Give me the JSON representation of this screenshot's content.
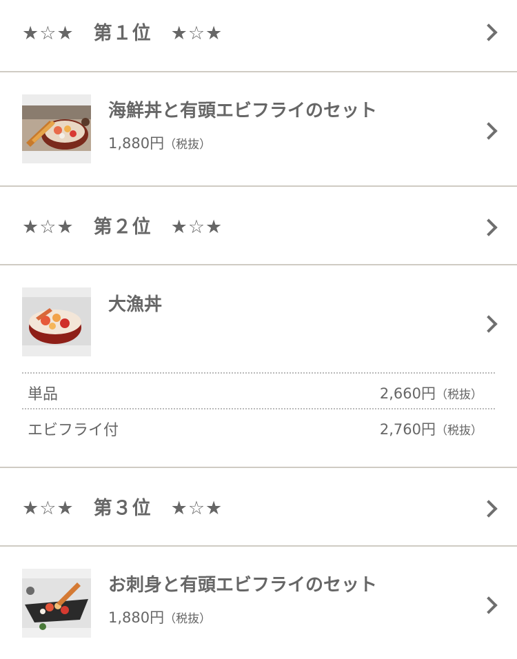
{
  "ranks": [
    {
      "label": "★☆★　第１位　★☆★"
    },
    {
      "label": "★☆★　第２位　★☆★"
    },
    {
      "label": "★☆★　第３位　★☆★"
    }
  ],
  "items": [
    {
      "title": "海鮮丼と有頭エビフライのセット",
      "price": "1,880円",
      "tax": "（税抜）",
      "image_icon": "kaisendon-ebi-fry-photo"
    },
    {
      "title": "大漁丼",
      "image_icon": "tairyodon-photo",
      "options": [
        {
          "label": "単品",
          "price": "2,660円",
          "tax": "（税抜）"
        },
        {
          "label": "エビフライ付",
          "price": "2,760円",
          "tax": "（税抜）"
        }
      ]
    },
    {
      "title": "お刺身と有頭エビフライのセット",
      "price": "1,880円",
      "tax": "（税抜）",
      "image_icon": "sashimi-ebi-fry-photo"
    }
  ],
  "colors": {
    "text": "#666666",
    "divider": "#cfcbc3",
    "dotted": "#b9b9b9",
    "chevron": "#6f6f6f"
  }
}
